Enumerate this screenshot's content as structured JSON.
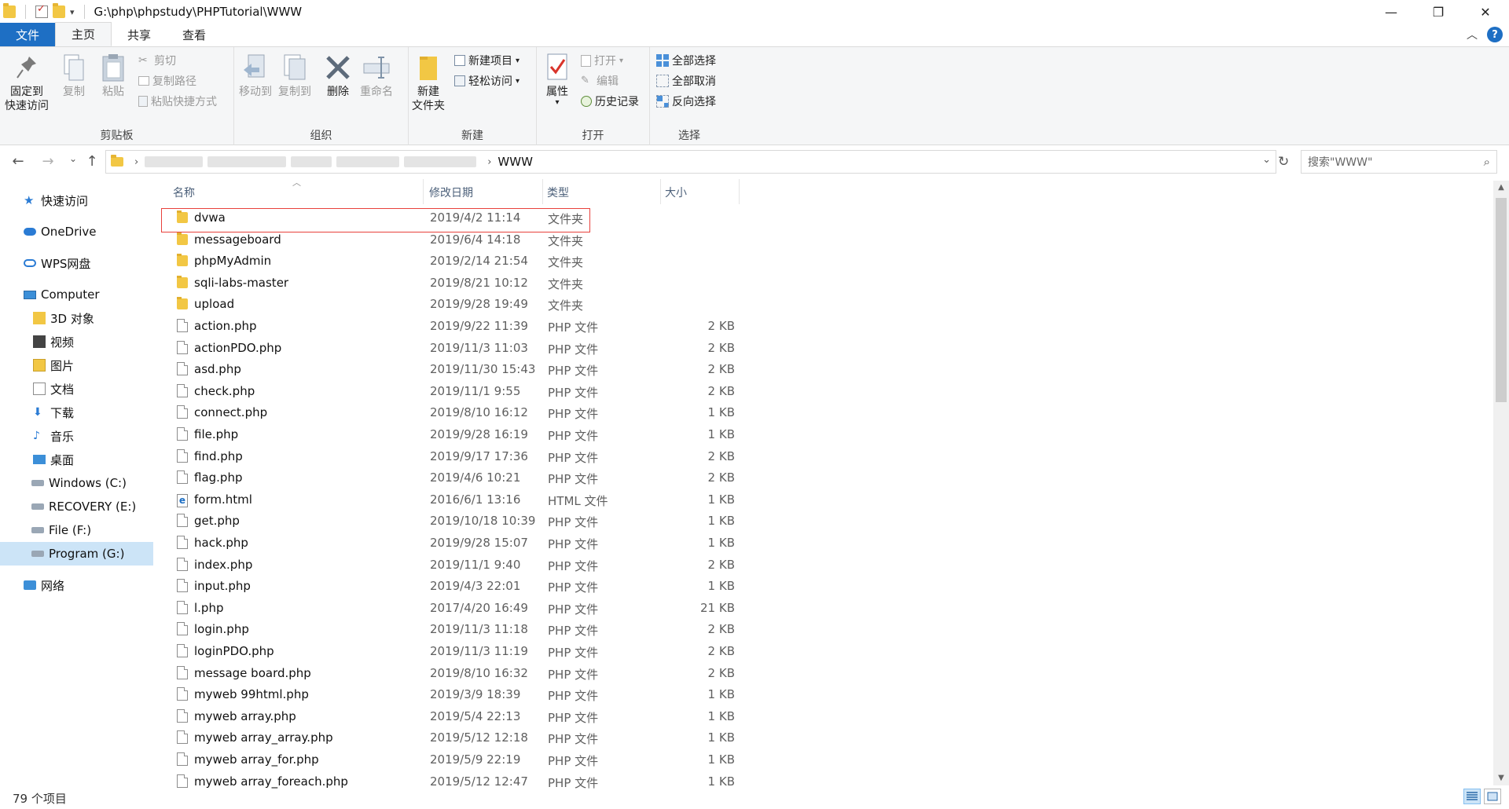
{
  "window": {
    "title_path": "G:\\php\\phpstudy\\PHPTutorial\\WWW",
    "minimize": "—",
    "restore": "❐",
    "close": "✕"
  },
  "tabs": [
    {
      "label": "文件"
    },
    {
      "label": "主页"
    },
    {
      "label": "共享"
    },
    {
      "label": "查看"
    }
  ],
  "ribbon": {
    "clipboard": {
      "pin_line1": "固定到",
      "pin_line2": "快速访问",
      "copy": "复制",
      "paste": "粘贴",
      "cut": "剪切",
      "copy_path": "复制路径",
      "paste_shortcut": "粘贴快捷方式",
      "label": "剪贴板"
    },
    "organize": {
      "move_to": "移动到",
      "copy_to": "复制到",
      "delete": "删除",
      "rename": "重命名",
      "label": "组织"
    },
    "new": {
      "new_folder_line1": "新建",
      "new_folder_line2": "文件夹",
      "new_item": "新建项目",
      "easy_access": "轻松访问",
      "label": "新建"
    },
    "open": {
      "properties": "属性",
      "open": "打开",
      "edit": "编辑",
      "history": "历史记录",
      "label": "打开"
    },
    "select": {
      "select_all": "全部选择",
      "select_none": "全部取消",
      "invert": "反向选择",
      "label": "选择"
    }
  },
  "address": {
    "current": "WWW",
    "search_placeholder": "搜索\"WWW\""
  },
  "nav": [
    {
      "label": "快速访问",
      "icon": "star-icon"
    },
    {
      "label": "OneDrive",
      "icon": "cloud-icon"
    },
    {
      "label": "WPS网盘",
      "icon": "cloud-icon"
    },
    {
      "label": "Computer",
      "icon": "computer-icon"
    },
    {
      "label": "3D 对象",
      "icon": "3d-objects-icon"
    },
    {
      "label": "视频",
      "icon": "video-icon"
    },
    {
      "label": "图片",
      "icon": "pictures-icon"
    },
    {
      "label": "文档",
      "icon": "documents-icon"
    },
    {
      "label": "下载",
      "icon": "download-icon"
    },
    {
      "label": "音乐",
      "icon": "music-icon"
    },
    {
      "label": "桌面",
      "icon": "desktop-icon"
    },
    {
      "label": "Windows (C:)",
      "icon": "drive-icon"
    },
    {
      "label": "RECOVERY (E:)",
      "icon": "drive-icon"
    },
    {
      "label": "File (F:)",
      "icon": "drive-icon"
    },
    {
      "label": "Program (G:)",
      "icon": "drive-icon"
    },
    {
      "label": "网络",
      "icon": "network-icon"
    }
  ],
  "columns": {
    "name": "名称",
    "date": "修改日期",
    "type": "类型",
    "size": "大小"
  },
  "files": [
    {
      "name": "dvwa",
      "date": "2019/4/2 11:14",
      "type": "文件夹",
      "size": "",
      "kind": "folder"
    },
    {
      "name": "messageboard",
      "date": "2019/6/4 14:18",
      "type": "文件夹",
      "size": "",
      "kind": "folder"
    },
    {
      "name": "phpMyAdmin",
      "date": "2019/2/14 21:54",
      "type": "文件夹",
      "size": "",
      "kind": "folder"
    },
    {
      "name": "sqli-labs-master",
      "date": "2019/8/21 10:12",
      "type": "文件夹",
      "size": "",
      "kind": "folder"
    },
    {
      "name": "upload",
      "date": "2019/9/28 19:49",
      "type": "文件夹",
      "size": "",
      "kind": "folder"
    },
    {
      "name": "action.php",
      "date": "2019/9/22 11:39",
      "type": "PHP 文件",
      "size": "2 KB",
      "kind": "file"
    },
    {
      "name": "actionPDO.php",
      "date": "2019/11/3 11:03",
      "type": "PHP 文件",
      "size": "2 KB",
      "kind": "file"
    },
    {
      "name": "asd.php",
      "date": "2019/11/30 15:43",
      "type": "PHP 文件",
      "size": "2 KB",
      "kind": "file"
    },
    {
      "name": "check.php",
      "date": "2019/11/1 9:55",
      "type": "PHP 文件",
      "size": "2 KB",
      "kind": "file"
    },
    {
      "name": "connect.php",
      "date": "2019/8/10 16:12",
      "type": "PHP 文件",
      "size": "1 KB",
      "kind": "file"
    },
    {
      "name": "file.php",
      "date": "2019/9/28 16:19",
      "type": "PHP 文件",
      "size": "1 KB",
      "kind": "file"
    },
    {
      "name": "find.php",
      "date": "2019/9/17 17:36",
      "type": "PHP 文件",
      "size": "2 KB",
      "kind": "file"
    },
    {
      "name": "flag.php",
      "date": "2019/4/6 10:21",
      "type": "PHP 文件",
      "size": "2 KB",
      "kind": "file"
    },
    {
      "name": "form.html",
      "date": "2016/6/1 13:16",
      "type": "HTML 文件",
      "size": "1 KB",
      "kind": "html"
    },
    {
      "name": "get.php",
      "date": "2019/10/18 10:39",
      "type": "PHP 文件",
      "size": "1 KB",
      "kind": "file"
    },
    {
      "name": "hack.php",
      "date": "2019/9/28 15:07",
      "type": "PHP 文件",
      "size": "1 KB",
      "kind": "file"
    },
    {
      "name": "index.php",
      "date": "2019/11/1 9:40",
      "type": "PHP 文件",
      "size": "2 KB",
      "kind": "file"
    },
    {
      "name": "input.php",
      "date": "2019/4/3 22:01",
      "type": "PHP 文件",
      "size": "1 KB",
      "kind": "file"
    },
    {
      "name": "l.php",
      "date": "2017/4/20 16:49",
      "type": "PHP 文件",
      "size": "21 KB",
      "kind": "file"
    },
    {
      "name": "login.php",
      "date": "2019/11/3 11:18",
      "type": "PHP 文件",
      "size": "2 KB",
      "kind": "file"
    },
    {
      "name": "loginPDO.php",
      "date": "2019/11/3 11:19",
      "type": "PHP 文件",
      "size": "2 KB",
      "kind": "file"
    },
    {
      "name": "message board.php",
      "date": "2019/8/10 16:32",
      "type": "PHP 文件",
      "size": "2 KB",
      "kind": "file"
    },
    {
      "name": "myweb 99html.php",
      "date": "2019/3/9 18:39",
      "type": "PHP 文件",
      "size": "1 KB",
      "kind": "file"
    },
    {
      "name": "myweb array.php",
      "date": "2019/5/4 22:13",
      "type": "PHP 文件",
      "size": "1 KB",
      "kind": "file"
    },
    {
      "name": "myweb array_array.php",
      "date": "2019/5/12 12:18",
      "type": "PHP 文件",
      "size": "1 KB",
      "kind": "file"
    },
    {
      "name": "myweb array_for.php",
      "date": "2019/5/9 22:19",
      "type": "PHP 文件",
      "size": "1 KB",
      "kind": "file"
    },
    {
      "name": "myweb array_foreach.php",
      "date": "2019/5/12 12:47",
      "type": "PHP 文件",
      "size": "1 KB",
      "kind": "file"
    }
  ],
  "status": {
    "count": "79 个项目"
  },
  "colors": {
    "accent": "#1e6fc4",
    "highlight_box": "#e8413c",
    "folder": "#f2c744",
    "selection": "#cce4f7"
  }
}
